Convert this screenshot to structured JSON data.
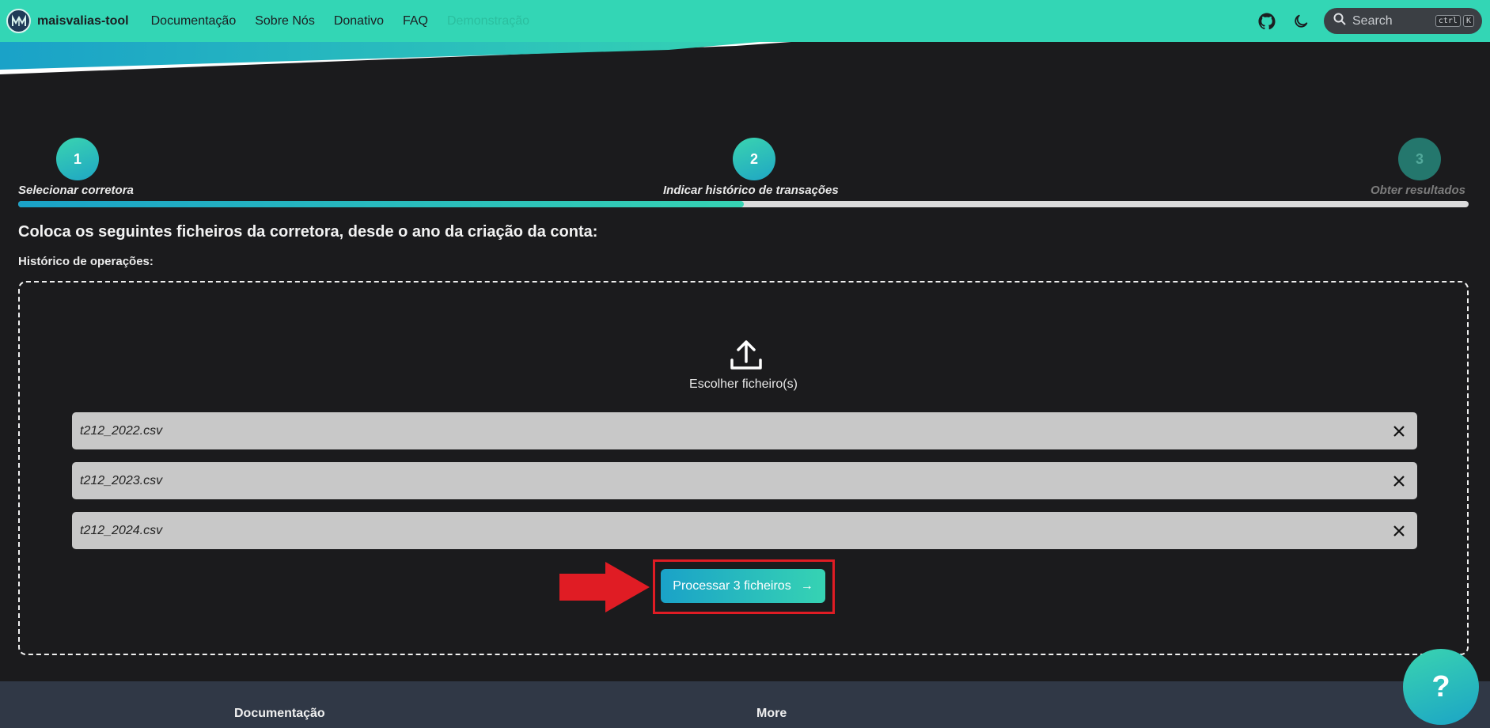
{
  "navbar": {
    "brand": "maisvalias-tool",
    "links": [
      "Documentação",
      "Sobre Nós",
      "Donativo",
      "FAQ"
    ],
    "disabled_link": "Demonstração",
    "search": {
      "label": "Search",
      "key1": "ctrl",
      "key2": "K"
    },
    "icons": [
      "github-icon",
      "moon-icon",
      "search-icon"
    ]
  },
  "stepper": {
    "progress_percent": 50,
    "steps": [
      {
        "number": "1",
        "label": "Selecionar corretora",
        "state": "done"
      },
      {
        "number": "2",
        "label": "Indicar histórico de transações",
        "state": "active"
      },
      {
        "number": "3",
        "label": "Obter resultados",
        "state": "pending"
      }
    ]
  },
  "main": {
    "heading": "Coloca os seguintes ficheiros da corretora, desde o ano da criação da conta:",
    "subheading": "Histórico de operações:",
    "dropzone": {
      "choose_label": "Escolher ficheiro(s)",
      "files": [
        "t212_2022.csv",
        "t212_2023.csv",
        "t212_2024.csv"
      ]
    },
    "process_button": "Processar 3 ficheiros",
    "process_arrow": "→"
  },
  "footer": {
    "col1": "Documentação",
    "col2": "More"
  },
  "help_button": "?",
  "colors": {
    "accent": "#33d6b5",
    "accent_blue": "#1aa2c8",
    "background": "#1b1b1d",
    "annotation_red": "#e01c24",
    "footer": "#303846"
  }
}
